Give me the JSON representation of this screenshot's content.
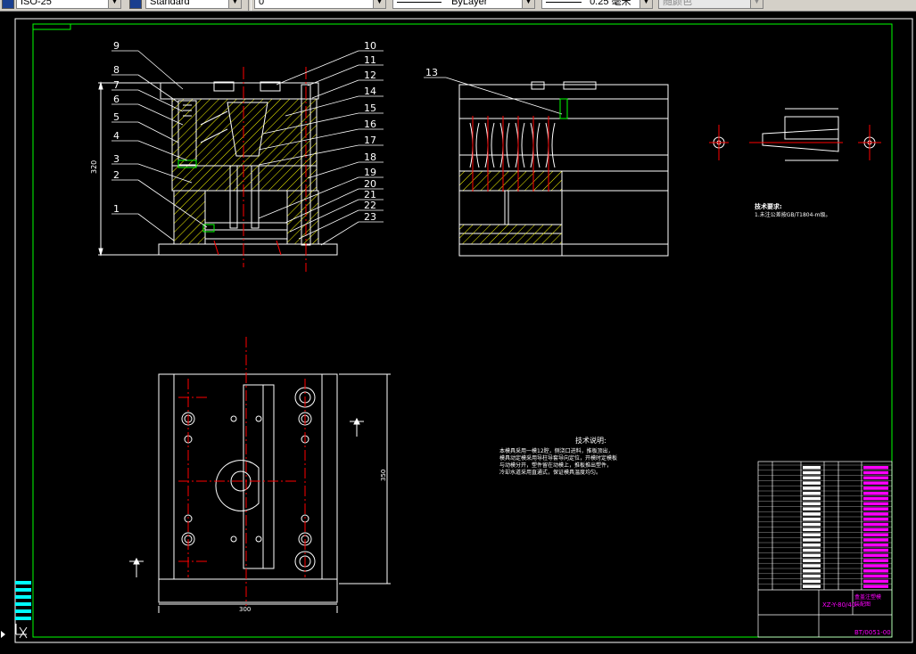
{
  "toolbar": {
    "dim_style": "ISO-25",
    "text_style": "Standard",
    "layer": "0",
    "linetype": "ByLayer",
    "lineweight": "0.25 毫米",
    "plot_color": "随颜色"
  },
  "drawing": {
    "part_numbers": [
      "1",
      "2",
      "3",
      "4",
      "5",
      "6",
      "7",
      "8",
      "9",
      "10",
      "11",
      "12",
      "13",
      "14",
      "15",
      "16",
      "17",
      "18",
      "19",
      "20",
      "21",
      "22",
      "23"
    ],
    "height_dim": "320",
    "plan_height_dim": "350",
    "plan_width_dim": "300",
    "tech_req_title": "技术要求:",
    "tech_req_text": "1.未注公差按GB/T1804-m级。",
    "tech_note_title": "技术说明:",
    "tech_note_lines": [
      "本模具采用一模12腔，侧浇口进料，推板顶出，",
      "模具动定模采用导柱导套导向定位，开模时定模板",
      "与动模分开，塑件留在动模上，推板推出塑件，",
      "冷却水道采用直通式，保证模具温度均匀。"
    ],
    "title_block": {
      "drawing_no": "XZ-Y-80/40",
      "name_line1": "盒盖注塑模",
      "name_line2": "装配图",
      "name_line3": "",
      "bottom_code": "BT/0051-00"
    }
  },
  "colors": {
    "drawing_line": "#ffffff",
    "center_line": "#ff0000",
    "hatch": "#ffff00",
    "border": "#00ff00",
    "magenta": "#ff00ff",
    "cyan": "#00ffff"
  }
}
